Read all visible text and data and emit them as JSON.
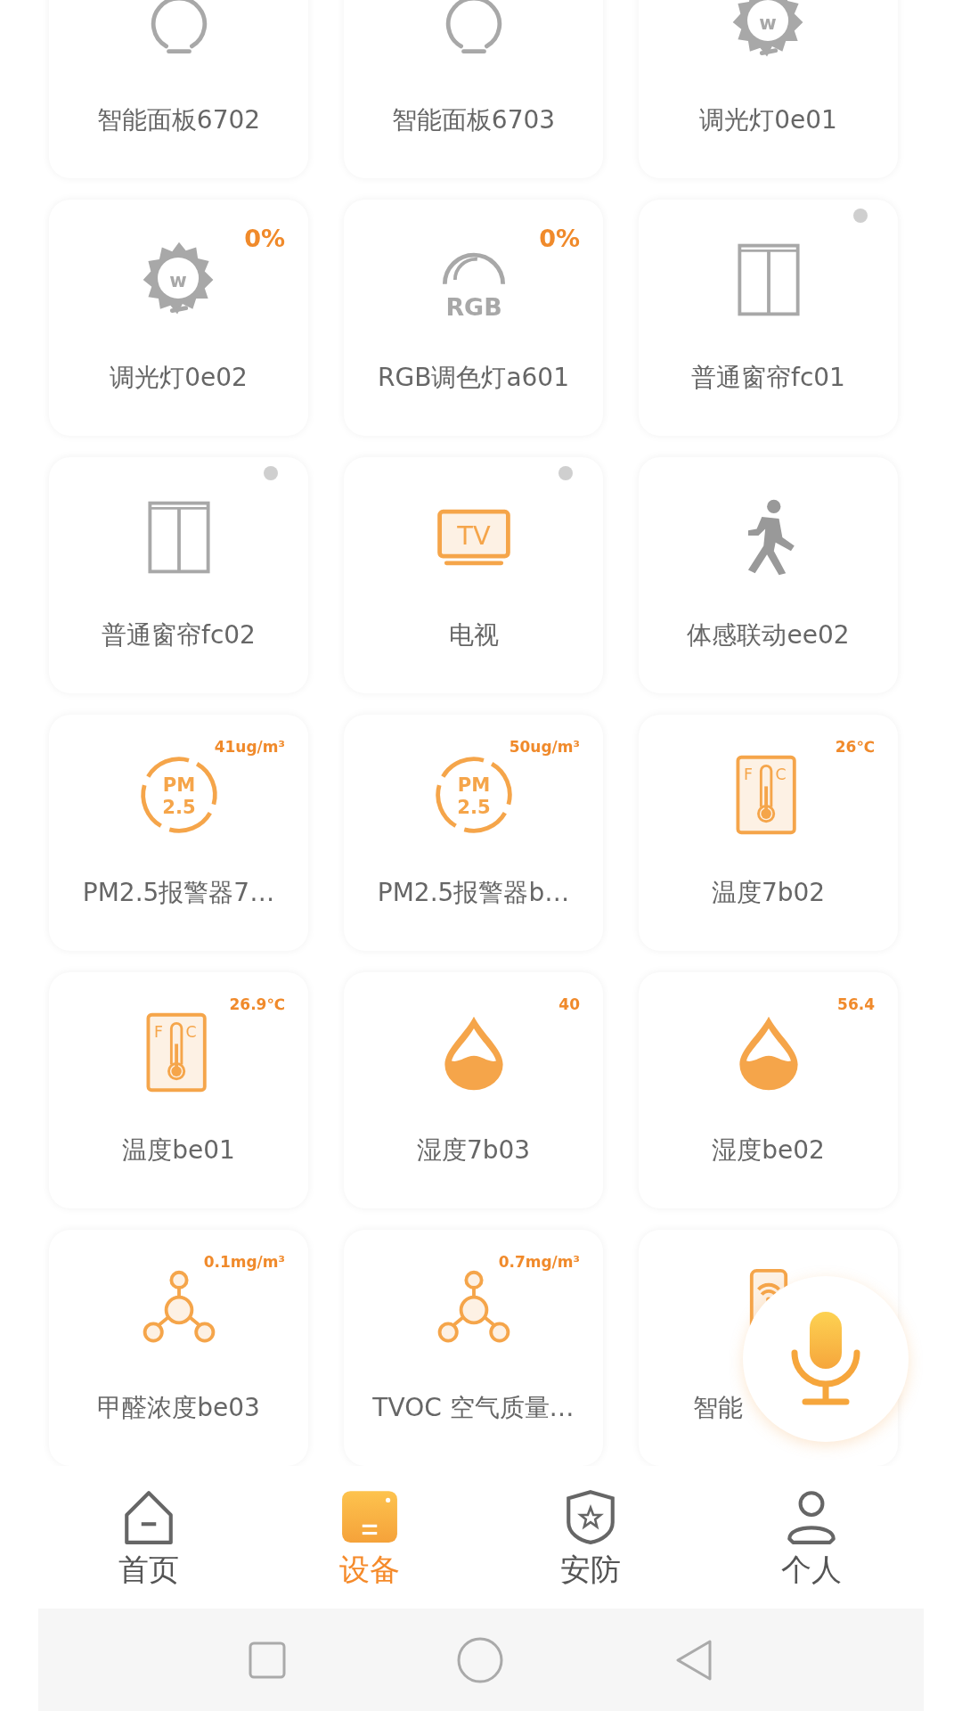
{
  "cards": [
    {
      "name": "智能面板6702",
      "kind": "bulb",
      "status_dot": false
    },
    {
      "name": "智能面板6703",
      "kind": "bulb",
      "status_dot": false
    },
    {
      "name": "调光灯0e01",
      "kind": "dimmer",
      "icon_text": [
        "w"
      ],
      "status_dot": false
    },
    {
      "name": "调光灯0e02",
      "kind": "dimmer",
      "icon_text": [
        "w"
      ],
      "badge": "0%",
      "status_dot": false
    },
    {
      "name": "RGB调色灯a601",
      "kind": "rgb",
      "icon_text": [
        "RGB"
      ],
      "badge": "0%",
      "status_dot": false
    },
    {
      "name": "普通窗帘fc01",
      "kind": "curtain",
      "status_dot": true
    },
    {
      "name": "普通窗帘fc02",
      "kind": "curtain",
      "status_dot": true
    },
    {
      "name": "电视",
      "kind": "tv",
      "icon_text": [
        "TV"
      ],
      "status_dot": true
    },
    {
      "name": "体感联动ee02",
      "kind": "motion",
      "status_dot": false
    },
    {
      "name": "PM2.5报警器7…",
      "kind": "pm25",
      "icon_text": [
        "PM",
        "2.5"
      ],
      "badge": "41ug/m³",
      "status_dot": false
    },
    {
      "name": "PM2.5报警器b…",
      "kind": "pm25",
      "icon_text": [
        "PM",
        "2.5"
      ],
      "badge": "50ug/m³",
      "status_dot": false
    },
    {
      "name": "温度7b02",
      "kind": "thermo",
      "icon_text": [
        "F",
        "C"
      ],
      "badge": "26℃",
      "status_dot": false
    },
    {
      "name": "温度be01",
      "kind": "thermo",
      "icon_text": [
        "F",
        "C"
      ],
      "badge": "26.9℃",
      "status_dot": false
    },
    {
      "name": "湿度7b03",
      "kind": "humidity",
      "badge": "40",
      "status_dot": false
    },
    {
      "name": "湿度be02",
      "kind": "humidity",
      "badge": "56.4",
      "status_dot": false
    },
    {
      "name": "甲醛浓度be03",
      "kind": "molecule",
      "badge": "0.1mg/m³",
      "status_dot": false
    },
    {
      "name": "TVOC 空气质量…",
      "kind": "molecule",
      "badge": "0.7mg/m³",
      "status_dot": false
    },
    {
      "name": "智能",
      "kind": "remote",
      "status_dot": false
    }
  ],
  "nav": [
    {
      "label": "首页",
      "kind": "home",
      "selected": false
    },
    {
      "label": "设备",
      "kind": "devices",
      "selected": true
    },
    {
      "label": "安防",
      "kind": "shield",
      "selected": false
    },
    {
      "label": "个人",
      "kind": "person",
      "selected": false
    }
  ]
}
